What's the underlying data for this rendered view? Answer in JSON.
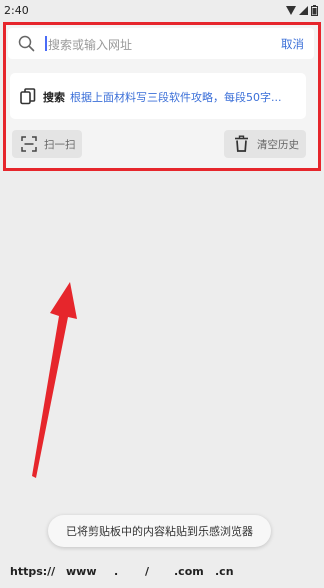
{
  "status_bar": {
    "time": "2:40"
  },
  "search": {
    "placeholder": "搜索或输入网址",
    "cancel_label": "取消"
  },
  "suggestion": {
    "label": "搜索",
    "text": "根据上面材料写三段软件攻略，每段50字..."
  },
  "actions": {
    "scan_label": "扫一扫",
    "clear_history_label": "清空历史"
  },
  "toast": {
    "text": "已将剪贴板中的内容粘贴到乐感浏览器"
  },
  "quick_inputs": [
    "https://",
    "www",
    ".",
    "/",
    ".com",
    ".cn"
  ],
  "colors": {
    "highlight": "#e6262c",
    "accent": "#3b6fd8",
    "background": "#ededed"
  }
}
